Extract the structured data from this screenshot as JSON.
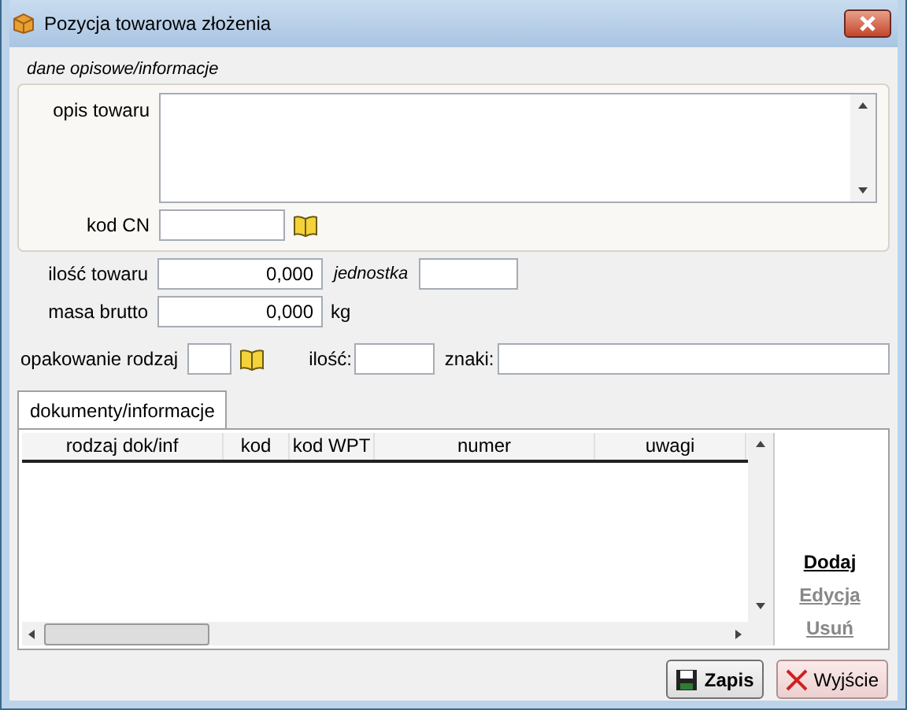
{
  "window": {
    "title": "Pozycja towarowa złożenia"
  },
  "description_group": {
    "title": "dane opisowe/informacje",
    "description_label": "opis towaru",
    "cn_label": "kod CN"
  },
  "quantity": {
    "label": "ilość towaru",
    "value": "0,000",
    "unit_label": "jednostka"
  },
  "gross_mass": {
    "label": "masa brutto",
    "value": "0,000",
    "unit": "kg"
  },
  "packaging": {
    "type_label": "opakowanie rodzaj",
    "count_label": "ilość:",
    "marks_label": "znaki:"
  },
  "tabs": [
    {
      "label": "dokumenty/informacje",
      "selected": true
    }
  ],
  "table": {
    "columns": [
      "rodzaj dok/inf",
      "kod",
      "kod WPT",
      "numer",
      "uwagi"
    ]
  },
  "side_links": [
    {
      "label": "Dodaj",
      "disabled": false
    },
    {
      "label": "Edycja",
      "disabled": true
    },
    {
      "label": "Usuń",
      "disabled": true
    }
  ],
  "buttons": [
    {
      "label": "Zapis",
      "kind": "save"
    },
    {
      "label": "Wyjście",
      "kind": "exit"
    }
  ]
}
